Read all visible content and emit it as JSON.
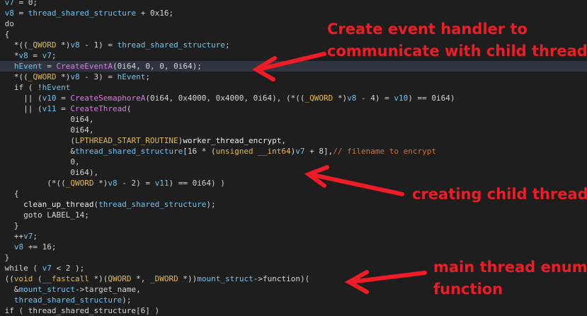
{
  "editor": {
    "lines": [
      {
        "hl": false,
        "tokens": [
          {
            "t": "v7",
            "c": "var"
          },
          {
            "t": " = 0;",
            "c": "plain"
          }
        ]
      },
      {
        "hl": false,
        "tokens": [
          {
            "t": "v8",
            "c": "var"
          },
          {
            "t": " = ",
            "c": "plain"
          },
          {
            "t": "thread_shared_structure",
            "c": "var"
          },
          {
            "t": " + 0x16;",
            "c": "plain"
          }
        ]
      },
      {
        "hl": false,
        "tokens": [
          {
            "t": "do",
            "c": "kw"
          }
        ]
      },
      {
        "hl": false,
        "tokens": [
          {
            "t": "{",
            "c": "plain"
          }
        ]
      },
      {
        "hl": false,
        "tokens": [
          {
            "t": "  *((",
            "c": "plain"
          },
          {
            "t": "_QWORD",
            "c": "type"
          },
          {
            "t": " *)",
            "c": "plain"
          },
          {
            "t": "v8",
            "c": "var"
          },
          {
            "t": " - 1) = ",
            "c": "plain"
          },
          {
            "t": "thread_shared_structure",
            "c": "var"
          },
          {
            "t": ";",
            "c": "plain"
          }
        ]
      },
      {
        "hl": false,
        "tokens": [
          {
            "t": "  *",
            "c": "plain"
          },
          {
            "t": "v8",
            "c": "var"
          },
          {
            "t": " = ",
            "c": "plain"
          },
          {
            "t": "v7",
            "c": "var"
          },
          {
            "t": ";",
            "c": "plain"
          }
        ]
      },
      {
        "hl": true,
        "tokens": [
          {
            "t": "  ",
            "c": "plain"
          },
          {
            "t": "hEvent",
            "c": "var"
          },
          {
            "t": " = ",
            "c": "plain"
          },
          {
            "t": "CreateEventA",
            "c": "func"
          },
          {
            "t": "(0i64, 0, 0, 0i64);",
            "c": "plain"
          }
        ]
      },
      {
        "hl": false,
        "tokens": [
          {
            "t": "  *((",
            "c": "plain"
          },
          {
            "t": "_QWORD",
            "c": "type"
          },
          {
            "t": " *)",
            "c": "plain"
          },
          {
            "t": "v8",
            "c": "var"
          },
          {
            "t": " - 3) = ",
            "c": "plain"
          },
          {
            "t": "hEvent",
            "c": "var"
          },
          {
            "t": ";",
            "c": "plain"
          }
        ]
      },
      {
        "hl": false,
        "tokens": [
          {
            "t": "  if ( !",
            "c": "plain"
          },
          {
            "t": "hEvent",
            "c": "var"
          }
        ]
      },
      {
        "hl": false,
        "tokens": [
          {
            "t": "    || (",
            "c": "plain"
          },
          {
            "t": "v10",
            "c": "var"
          },
          {
            "t": " = ",
            "c": "plain"
          },
          {
            "t": "CreateSemaphoreA",
            "c": "func"
          },
          {
            "t": "(0i64, 0x4000, 0x4000, 0i64), (*((",
            "c": "plain"
          },
          {
            "t": "_QWORD",
            "c": "type"
          },
          {
            "t": " *)",
            "c": "plain"
          },
          {
            "t": "v8",
            "c": "var"
          },
          {
            "t": " - 4) = ",
            "c": "plain"
          },
          {
            "t": "v10",
            "c": "var"
          },
          {
            "t": ") == 0i64)",
            "c": "plain"
          }
        ]
      },
      {
        "hl": false,
        "tokens": [
          {
            "t": "    || (",
            "c": "plain"
          },
          {
            "t": "v11",
            "c": "var"
          },
          {
            "t": " = ",
            "c": "plain"
          },
          {
            "t": "CreateThread",
            "c": "func"
          },
          {
            "t": "(",
            "c": "plain"
          }
        ]
      },
      {
        "hl": false,
        "tokens": [
          {
            "t": "              0i64,",
            "c": "plain"
          }
        ]
      },
      {
        "hl": false,
        "tokens": [
          {
            "t": "              0i64,",
            "c": "plain"
          }
        ]
      },
      {
        "hl": false,
        "tokens": [
          {
            "t": "              (",
            "c": "plain"
          },
          {
            "t": "LPTHREAD_START_ROUTINE",
            "c": "type"
          },
          {
            "t": ")",
            "c": "plain"
          },
          {
            "t": "worker_thread_encrypt",
            "c": "param"
          },
          {
            "t": ",",
            "c": "plain"
          }
        ]
      },
      {
        "hl": false,
        "tokens": [
          {
            "t": "              &",
            "c": "plain"
          },
          {
            "t": "thread_shared_structure",
            "c": "var"
          },
          {
            "t": "[16 * (",
            "c": "plain"
          },
          {
            "t": "unsigned __int64",
            "c": "type"
          },
          {
            "t": ")",
            "c": "plain"
          },
          {
            "t": "v7",
            "c": "var"
          },
          {
            "t": " + 8],",
            "c": "plain"
          },
          {
            "t": "// filename to encrypt",
            "c": "cmt"
          }
        ]
      },
      {
        "hl": false,
        "tokens": [
          {
            "t": "              0,",
            "c": "plain"
          }
        ]
      },
      {
        "hl": false,
        "tokens": [
          {
            "t": "              0i64),",
            "c": "plain"
          }
        ]
      },
      {
        "hl": false,
        "tokens": [
          {
            "t": "         (*((",
            "c": "plain"
          },
          {
            "t": "_QWORD",
            "c": "type"
          },
          {
            "t": " *)",
            "c": "plain"
          },
          {
            "t": "v8",
            "c": "var"
          },
          {
            "t": " - 2) = ",
            "c": "plain"
          },
          {
            "t": "v11",
            "c": "var"
          },
          {
            "t": ") == 0i64) )",
            "c": "plain"
          }
        ]
      },
      {
        "hl": false,
        "tokens": [
          {
            "t": "  {",
            "c": "plain"
          }
        ]
      },
      {
        "hl": false,
        "tokens": [
          {
            "t": "    ",
            "c": "plain"
          },
          {
            "t": "clean_up_thread",
            "c": "param"
          },
          {
            "t": "(",
            "c": "plain"
          },
          {
            "t": "thread_shared_structure",
            "c": "var"
          },
          {
            "t": ");",
            "c": "plain"
          }
        ]
      },
      {
        "hl": false,
        "tokens": [
          {
            "t": "    goto LABEL_14;",
            "c": "plain"
          }
        ]
      },
      {
        "hl": false,
        "tokens": [
          {
            "t": "  }",
            "c": "plain"
          }
        ]
      },
      {
        "hl": false,
        "tokens": [
          {
            "t": "  ++",
            "c": "plain"
          },
          {
            "t": "v7",
            "c": "var"
          },
          {
            "t": ";",
            "c": "plain"
          }
        ]
      },
      {
        "hl": false,
        "tokens": [
          {
            "t": "  ",
            "c": "plain"
          },
          {
            "t": "v8",
            "c": "var"
          },
          {
            "t": " += 16;",
            "c": "plain"
          }
        ]
      },
      {
        "hl": false,
        "tokens": [
          {
            "t": "}",
            "c": "plain"
          }
        ]
      },
      {
        "hl": false,
        "tokens": [
          {
            "t": "while ( ",
            "c": "plain"
          },
          {
            "t": "v7",
            "c": "var"
          },
          {
            "t": " < 2 );",
            "c": "plain"
          }
        ]
      },
      {
        "hl": false,
        "tokens": [
          {
            "t": "((",
            "c": "plain"
          },
          {
            "t": "void",
            "c": "type"
          },
          {
            "t": " (",
            "c": "plain"
          },
          {
            "t": "__fastcall",
            "c": "type"
          },
          {
            "t": " *)(",
            "c": "plain"
          },
          {
            "t": "QWORD",
            "c": "type"
          },
          {
            "t": " *, ",
            "c": "plain"
          },
          {
            "t": "_DWORD",
            "c": "type"
          },
          {
            "t": " *))",
            "c": "plain"
          },
          {
            "t": "mount_struct",
            "c": "var"
          },
          {
            "t": "->function)(",
            "c": "plain"
          }
        ]
      },
      {
        "hl": false,
        "tokens": [
          {
            "t": "  &",
            "c": "plain"
          },
          {
            "t": "mount_struct",
            "c": "var"
          },
          {
            "t": "->target_name,",
            "c": "plain"
          }
        ]
      },
      {
        "hl": false,
        "tokens": [
          {
            "t": "  ",
            "c": "plain"
          },
          {
            "t": "thread_shared_structure",
            "c": "var"
          },
          {
            "t": ");",
            "c": "plain"
          }
        ]
      },
      {
        "hl": false,
        "tokens": [
          {
            "t": "if ( thread_shared_structure[6] )",
            "c": "plain"
          }
        ]
      }
    ]
  },
  "annotations": [
    {
      "id": "annot-1",
      "lines": [
        "Create event handler to",
        "communicate with child thread"
      ]
    },
    {
      "id": "annot-2",
      "lines": [
        "creating child thread"
      ]
    },
    {
      "id": "annot-3",
      "lines": [
        "main thread enum",
        "function"
      ]
    }
  ],
  "colors": {
    "background": "#1e1e1e",
    "highlight_line": "#2f3440",
    "annotation_red": "#ee1c25"
  }
}
